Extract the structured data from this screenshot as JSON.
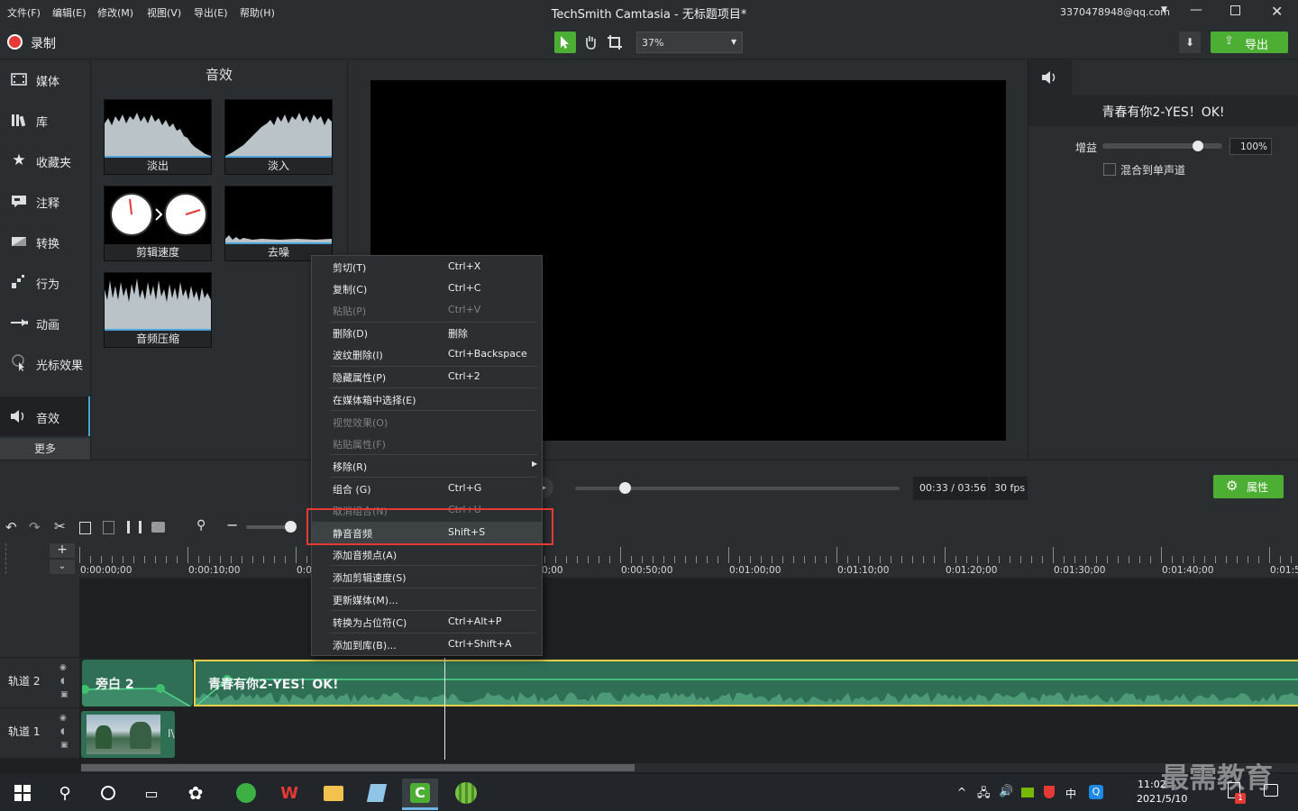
{
  "menubar": {
    "items": [
      "文件(F)",
      "编辑(E)",
      "修改(M)",
      "视图(V)",
      "导出(E)",
      "帮助(H)"
    ],
    "title": "TechSmith Camtasia - 无标题项目*",
    "account": "3370478948@qq.com"
  },
  "toolbar": {
    "record_label": "录制",
    "zoom": "37%",
    "export_label": "导出"
  },
  "left_nav": {
    "items": [
      "媒体",
      "库",
      "收藏夹",
      "注释",
      "转换",
      "行为",
      "动画",
      "光标效果",
      "音效"
    ],
    "more_label": "更多"
  },
  "effects": {
    "title": "音效",
    "items": [
      "淡出",
      "淡入",
      "剪辑速度",
      "去噪",
      "音频压缩"
    ]
  },
  "properties": {
    "clip_title": "青春有你2-YES！OK!",
    "gain_label": "增益",
    "gain_value": "100%",
    "gain_level": 0.8,
    "mono_label": "混合到单声道"
  },
  "playbar": {
    "time": "00:33 / 03:56",
    "fps": "30 fps",
    "props_label": "属性"
  },
  "timeline": {
    "ruler": [
      "0:00:00;00",
      "0:00:10;00",
      "0:0",
      "0;00",
      "0:00:50;00",
      "0:01:00;00",
      "0:01:10;00",
      "0:01:20;00",
      "0:01:30;00",
      "0:01:40;00",
      "0:01:5"
    ],
    "track2_label": "轨道 2",
    "track1_label": "轨道 1",
    "clip_narration": "旁白 2",
    "clip_music": "青春有你2-YES！OK!",
    "clip_video_tag": "I\\"
  },
  "context_menu": {
    "items": [
      {
        "label": "剪切(T)",
        "shortcut": "Ctrl+X"
      },
      {
        "label": "复制(C)",
        "shortcut": "Ctrl+C"
      },
      {
        "label": "粘贴(P)",
        "shortcut": "Ctrl+V"
      },
      {
        "label": "删除(D)",
        "shortcut": "删除"
      },
      {
        "label": "波纹删除(I)",
        "shortcut": "Ctrl+Backspace"
      },
      {
        "label": "隐藏属性(P)",
        "shortcut": "Ctrl+2"
      },
      {
        "label": "在媒体箱中选择(E)",
        "shortcut": ""
      },
      {
        "label": "视觉效果(O)",
        "shortcut": ""
      },
      {
        "label": "粘贴属性(F)",
        "shortcut": ""
      },
      {
        "label": "移除(R)",
        "shortcut": ""
      },
      {
        "label": "组合 (G)",
        "shortcut": "Ctrl+G"
      },
      {
        "label": "取消组合(N)",
        "shortcut": "Ctrl+U"
      },
      {
        "label": "静音音频",
        "shortcut": "Shift+S"
      },
      {
        "label": "添加音频点(A)",
        "shortcut": ""
      },
      {
        "label": "添加剪辑速度(S)",
        "shortcut": ""
      },
      {
        "label": "更新媒体(M)...",
        "shortcut": ""
      },
      {
        "label": "转换为占位符(C)",
        "shortcut": "Ctrl+Alt+P"
      },
      {
        "label": "添加到库(B)...",
        "shortcut": "Ctrl+Shift+A"
      }
    ]
  },
  "taskbar": {
    "time": "11:02",
    "date": "2021/5/10",
    "ime": "中",
    "badge": "1",
    "watermark": "最需教育"
  },
  "colors": {
    "accent_green": "#4caf33",
    "clip_green": "#3c8a67",
    "highlight_red": "#e53935"
  }
}
